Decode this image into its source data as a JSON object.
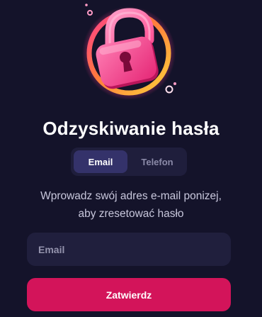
{
  "header": {
    "title": "Odzyskiwanie hasła"
  },
  "tabs": [
    {
      "label": "Email",
      "active": true
    },
    {
      "label": "Telefon",
      "active": false
    }
  ],
  "instructions": {
    "line1": "Wprowadz swój adres e-mail ponizej,",
    "line2": "aby zresetować hasło"
  },
  "form": {
    "email_placeholder": "Email",
    "email_value": "",
    "submit_label": "Zatwierdz"
  },
  "colors": {
    "background": "#14132a",
    "accent": "#d3145a",
    "lock_pink": "#ff4f93",
    "ring_gold": "#f5c33b"
  },
  "icons": {
    "hero": "padlock-icon"
  }
}
